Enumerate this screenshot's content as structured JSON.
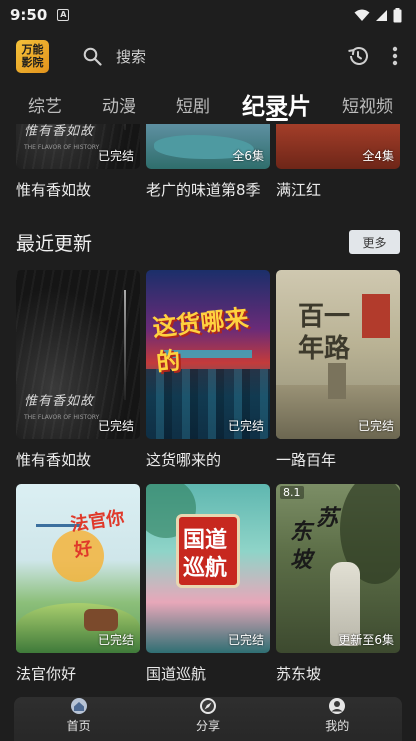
{
  "status_bar": {
    "time": "9:50",
    "notification_letter": "A"
  },
  "header": {
    "logo_line1": "万能",
    "logo_line2": "影院",
    "search_placeholder": "搜索",
    "icons": [
      "search-icon",
      "history-icon",
      "more-vert-icon"
    ]
  },
  "tabs": [
    {
      "label": "综艺",
      "active": false
    },
    {
      "label": "动漫",
      "active": false
    },
    {
      "label": "短剧",
      "active": false
    },
    {
      "label": "纪录片",
      "active": true
    },
    {
      "label": "短视频",
      "active": false
    }
  ],
  "top_row": [
    {
      "title": "惟有香如故",
      "badge": "已完结"
    },
    {
      "title": "老广的味道第8季",
      "badge": "全6集"
    },
    {
      "title": "满江红",
      "badge": "全4集"
    }
  ],
  "recent_section": {
    "title": "最近更新",
    "more_label": "更多"
  },
  "recent_row1": [
    {
      "title": "惟有香如故",
      "badge": "已完结",
      "poster_calli": "惟有香如故",
      "poster_sub": "THE FLAVOR OF HISTORY"
    },
    {
      "title": "这货哪来的",
      "badge": "已完结",
      "poster_text": "这货哪来的"
    },
    {
      "title": "一路百年",
      "badge": "已完结",
      "poster_text_1": "百一",
      "poster_text_2": "年路"
    }
  ],
  "recent_row2": [
    {
      "title": "法官你好",
      "badge": "已完结",
      "poster_text": "法官你好"
    },
    {
      "title": "国道巡航",
      "badge": "已完结",
      "poster_text_1": "国道",
      "poster_text_2": "巡航"
    },
    {
      "title": "苏东坡",
      "badge": "更新至6集",
      "rating": "8.1",
      "poster_text_1": "苏",
      "poster_text_2": "东",
      "poster_text_3": "坡"
    }
  ],
  "bottom_nav": [
    {
      "label": "首页",
      "icon": "home-icon",
      "active": true
    },
    {
      "label": "分享",
      "icon": "compass-icon",
      "active": false
    },
    {
      "label": "我的",
      "icon": "profile-icon",
      "active": false
    }
  ]
}
